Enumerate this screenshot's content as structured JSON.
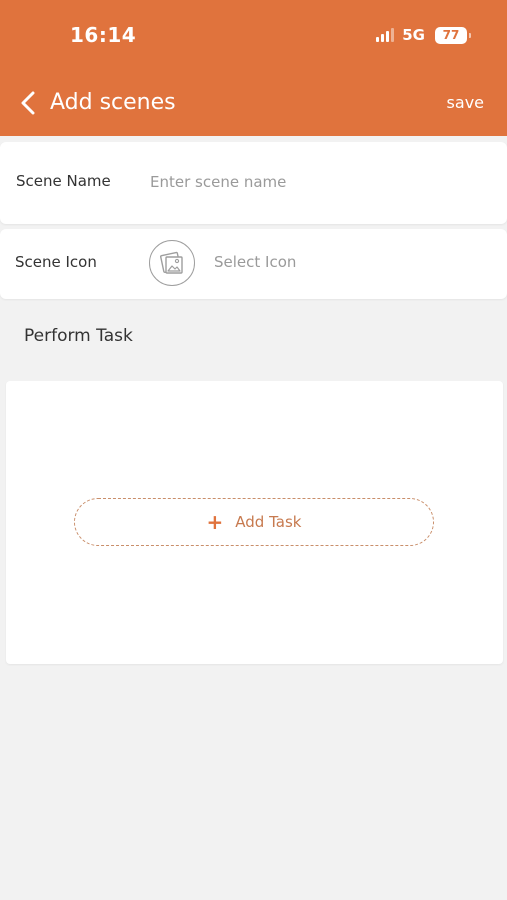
{
  "status_bar": {
    "time": "16:14",
    "network": "5G",
    "battery": "77"
  },
  "header": {
    "title": "Add scenes",
    "save_label": "save",
    "back_icon": "chevron-left-icon"
  },
  "form": {
    "scene_name_label": "Scene Name",
    "scene_name_value": "",
    "scene_name_placeholder": "Enter scene name",
    "scene_icon_label": "Scene Icon",
    "scene_icon_icon": "image-placeholder-icon",
    "select_icon_label": "Select Icon"
  },
  "tasks": {
    "section_title": "Perform Task",
    "add_task_label": "Add Task",
    "add_icon": "plus-icon"
  },
  "colors": {
    "accent": "#e0733d",
    "background": "#f2f2f2"
  }
}
